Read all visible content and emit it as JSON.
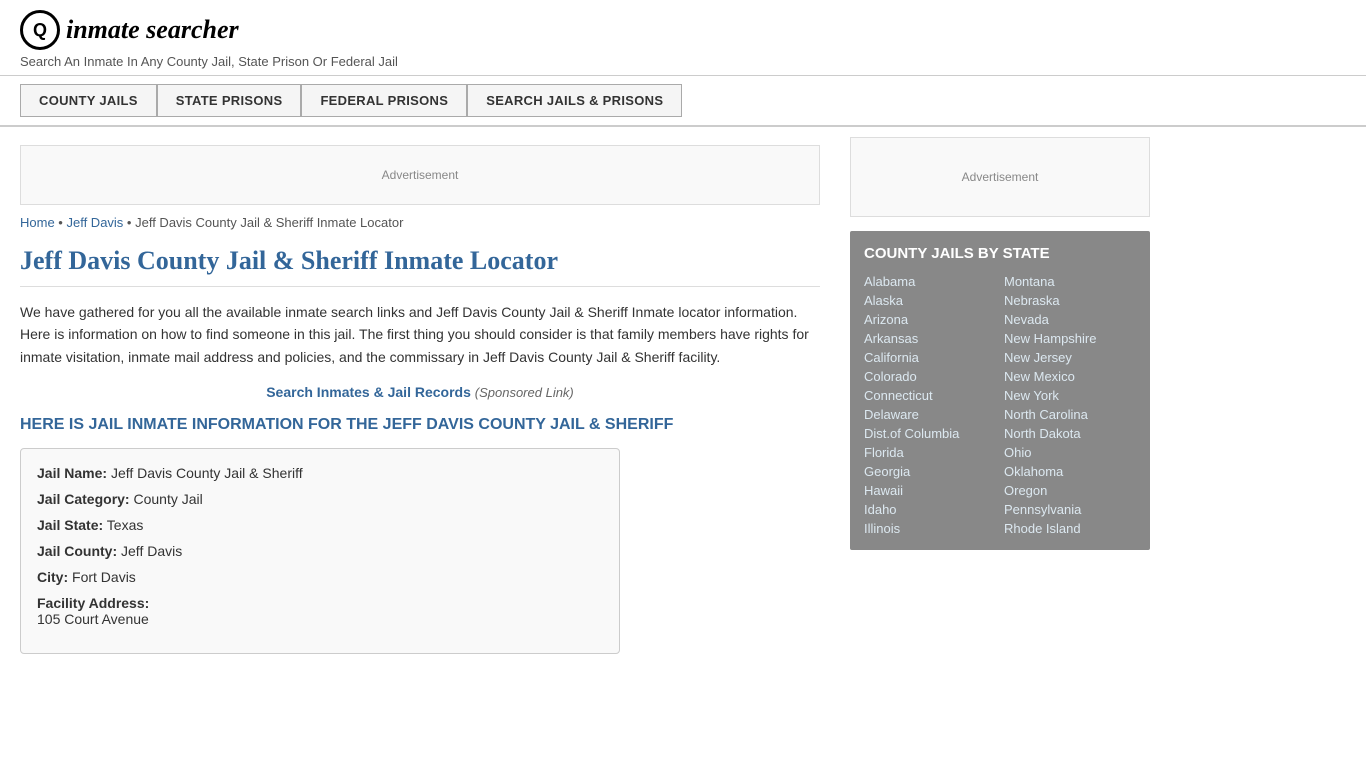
{
  "header": {
    "logo_icon": "Q",
    "logo_text": "inmate searcher",
    "tagline": "Search An Inmate In Any County Jail, State Prison Or Federal Jail"
  },
  "nav": {
    "items": [
      {
        "label": "COUNTY JAILS",
        "id": "county-jails"
      },
      {
        "label": "STATE PRISONS",
        "id": "state-prisons"
      },
      {
        "label": "FEDERAL PRISONS",
        "id": "federal-prisons"
      },
      {
        "label": "SEARCH JAILS & PRISONS",
        "id": "search-jails"
      }
    ]
  },
  "ad": {
    "top_label": "Advertisement",
    "sidebar_label": "Advertisement"
  },
  "breadcrumb": {
    "home": "Home",
    "county": "Jeff Davis",
    "current": "Jeff Davis County Jail & Sheriff Inmate Locator"
  },
  "page": {
    "title": "Jeff Davis County Jail & Sheriff Inmate Locator",
    "body_text": "We have gathered for you all the available inmate search links and Jeff Davis County Jail & Sheriff Inmate locator information. Here is information on how to find someone in this jail. The first thing you should consider is that family members have rights for inmate visitation, inmate mail address and policies, and the commissary in Jeff Davis County Jail & Sheriff facility.",
    "sponsored_link_text": "Search Inmates & Jail Records",
    "sponsored_note": "(Sponsored Link)",
    "section_heading": "HERE IS JAIL INMATE INFORMATION FOR THE JEFF DAVIS COUNTY JAIL & SHERIFF"
  },
  "info_box": {
    "jail_name_label": "Jail Name:",
    "jail_name_value": "Jeff Davis County Jail & Sheriff",
    "jail_category_label": "Jail Category:",
    "jail_category_value": "County Jail",
    "jail_state_label": "Jail State:",
    "jail_state_value": "Texas",
    "jail_county_label": "Jail County:",
    "jail_county_value": "Jeff Davis",
    "city_label": "City:",
    "city_value": "Fort Davis",
    "facility_address_label": "Facility Address:",
    "facility_address_value": "105 Court Avenue"
  },
  "sidebar": {
    "county_jails_title": "COUNTY JAILS BY STATE",
    "states_col1": [
      "Alabama",
      "Alaska",
      "Arizona",
      "Arkansas",
      "California",
      "Colorado",
      "Connecticut",
      "Delaware",
      "Dist.of Columbia",
      "Florida",
      "Georgia",
      "Hawaii",
      "Idaho",
      "Illinois"
    ],
    "states_col2": [
      "Montana",
      "Nebraska",
      "Nevada",
      "New Hampshire",
      "New Jersey",
      "New Mexico",
      "New York",
      "North Carolina",
      "North Dakota",
      "Ohio",
      "Oklahoma",
      "Oregon",
      "Pennsylvania",
      "Rhode Island"
    ]
  }
}
